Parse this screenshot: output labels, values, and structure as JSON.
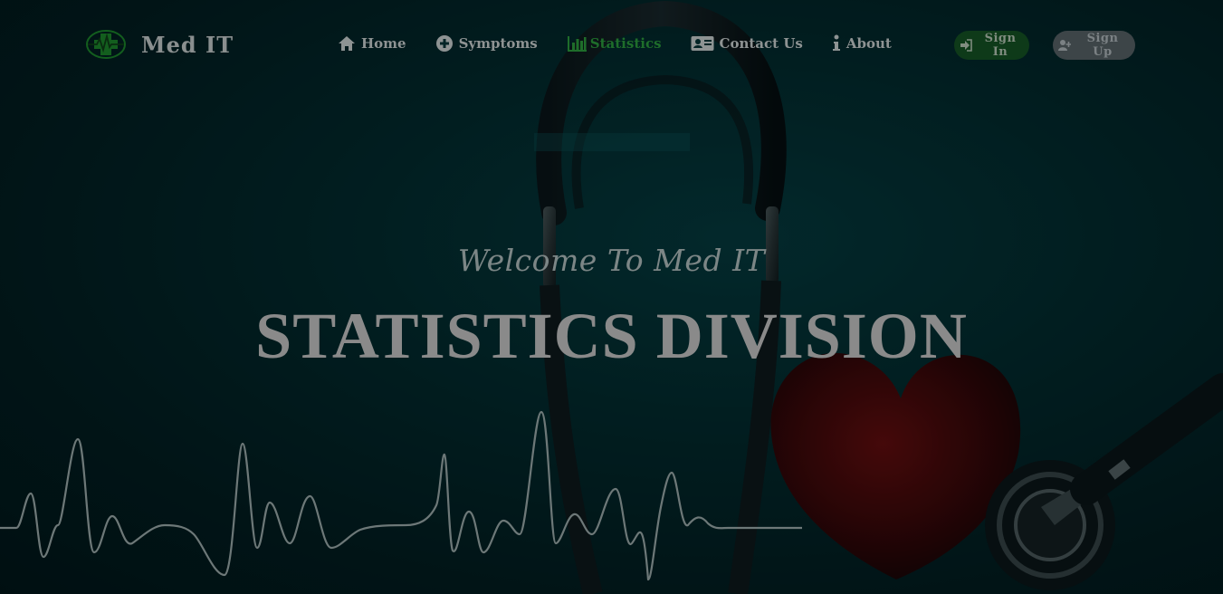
{
  "brand": {
    "name": "Med IT",
    "logo_icon": "medical-cross-pulse-icon",
    "accent_color": "#1e8a2e"
  },
  "nav": {
    "items": [
      {
        "label": "Home",
        "icon": "home-icon",
        "active": false
      },
      {
        "label": "Symptoms",
        "icon": "plus-circle-icon",
        "active": false
      },
      {
        "label": "Statistics",
        "icon": "bar-chart-icon",
        "active": true
      },
      {
        "label": "Contact Us",
        "icon": "address-card-icon",
        "active": false
      },
      {
        "label": "About",
        "icon": "info-icon",
        "active": false
      }
    ],
    "active_color": "#1e6d2a"
  },
  "auth": {
    "sign_in_label": "Sign In",
    "sign_in_icon": "sign-in-icon",
    "sign_up_label": "Sign Up",
    "sign_up_icon": "user-plus-icon"
  },
  "hero": {
    "welcome": "Welcome To Med IT",
    "title": "STATISTICS DIVISION"
  }
}
